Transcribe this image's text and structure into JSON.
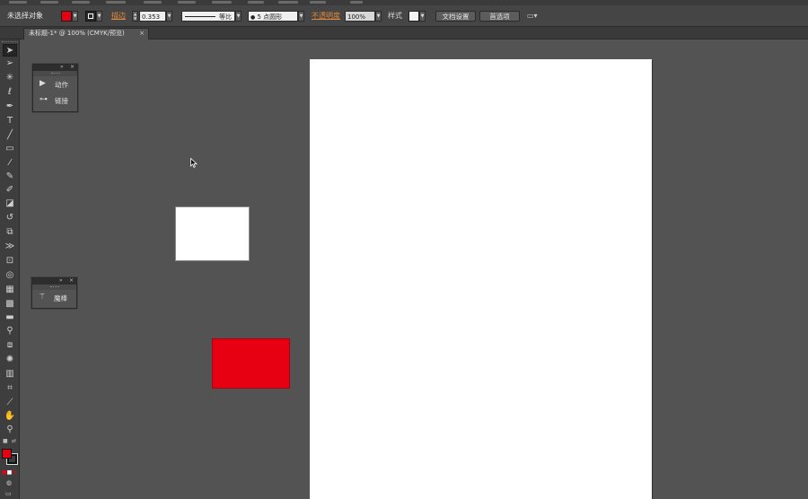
{
  "menubar": {
    "item_count": 11
  },
  "control_bar": {
    "selection_status": "未选择对象",
    "fill_color": "#e60012",
    "stroke_label": "描边",
    "stroke_weight": "0.353",
    "stroke_profile": "等比",
    "brush": "5 点圆形",
    "opacity_label": "不透明度",
    "opacity_value": "100%",
    "style_label": "样式",
    "doc_setup_button": "文档设置",
    "preferences_button": "首选项"
  },
  "document_tab": {
    "title": "未标题-1* @ 100% (CMYK/预览)",
    "close": "×"
  },
  "panels": {
    "actions_links": {
      "items": [
        {
          "icon": "play-icon",
          "label": "动作"
        },
        {
          "icon": "link-icon",
          "label": "链接"
        }
      ]
    },
    "magic_wand": {
      "items": [
        {
          "icon": "magic-wand-icon",
          "label": "魔棒"
        }
      ]
    }
  },
  "tools": [
    "selection-tool",
    "direct-selection-tool",
    "magic-wand-tool",
    "lasso-tool",
    "pen-tool",
    "type-tool",
    "line-tool",
    "rectangle-tool",
    "paintbrush-tool",
    "pencil-tool",
    "blob-brush-tool",
    "eraser-tool",
    "rotate-tool",
    "scale-tool",
    "width-tool",
    "free-transform-tool",
    "shape-builder-tool",
    "perspective-grid-tool",
    "mesh-tool",
    "gradient-tool",
    "eyedropper-tool",
    "blend-tool",
    "symbol-sprayer-tool",
    "column-graph-tool",
    "artboard-tool",
    "slice-tool",
    "hand-tool",
    "zoom-tool"
  ],
  "colors": {
    "fill": "#e60012",
    "stroke": "#ffffff",
    "canvas_bg": "#535353",
    "artboard": "#ffffff",
    "red_shape": "#e60012"
  }
}
